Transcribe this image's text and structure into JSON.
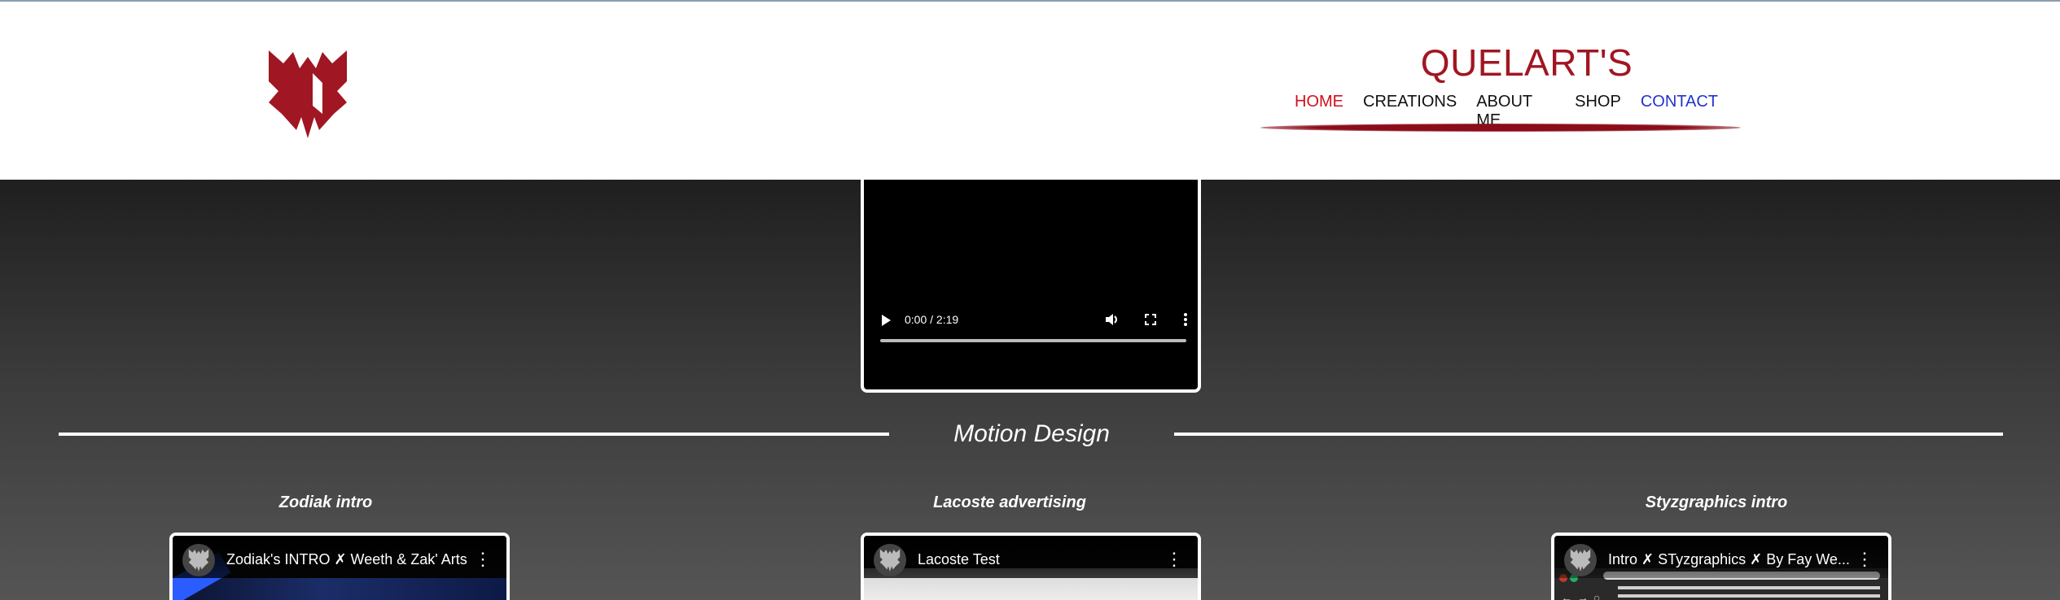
{
  "header": {
    "brand": "QUELART'S",
    "nav": [
      {
        "label": "HOME"
      },
      {
        "label": "CREATIONS"
      },
      {
        "label": "ABOUT ME"
      },
      {
        "label": "SHOP"
      },
      {
        "label": "CONTACT"
      }
    ],
    "colors": {
      "brand": "#a01622",
      "home": "#d0101c",
      "contact": "#2233cc"
    }
  },
  "featured_video": {
    "time": "0:00 / 2:19"
  },
  "section": {
    "title": "Motion Design"
  },
  "items": [
    {
      "title": "Zodiak intro",
      "video_title": "Zodiak's INTRO ✗ Weeth & Zak' Arts"
    },
    {
      "title": "Lacoste advertising",
      "video_title": "Lacoste Test"
    },
    {
      "title": "Styzgraphics intro",
      "video_title": "Intro ✗ STyzgraphics ✗ By Fay We..."
    }
  ],
  "icons": {
    "logo": "bat-wings-logo",
    "play": "play-icon",
    "volume": "volume-icon",
    "fullscreen": "fullscreen-icon",
    "more": "more-vert-icon"
  }
}
